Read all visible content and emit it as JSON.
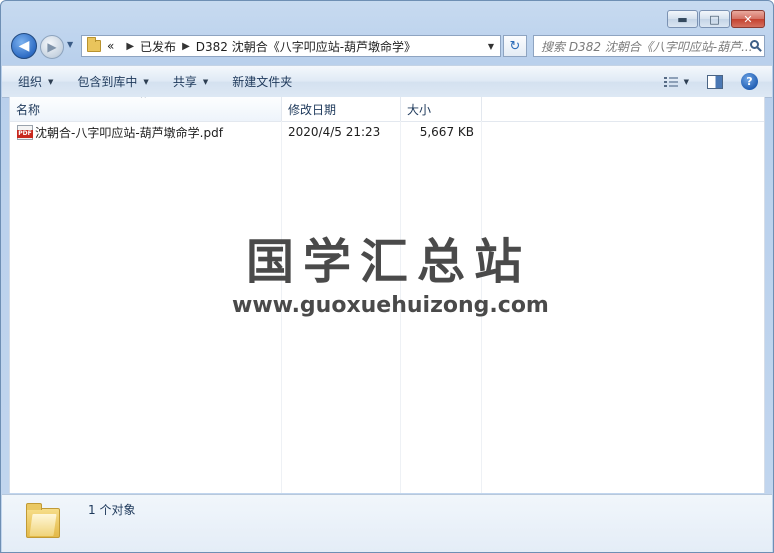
{
  "window": {
    "caption_buttons": {
      "minimize": "▬",
      "maximize": "□",
      "close": "✕"
    }
  },
  "address": {
    "overflow": "«",
    "crumbs": [
      "已发布",
      "D382 沈朝合《八字叩应站-葫芦墩命学》"
    ],
    "separator": "▶",
    "dropdown": "▼",
    "refresh": "↻"
  },
  "search": {
    "placeholder": "搜索 D382 沈朝合《八字叩应站-葫芦..."
  },
  "toolbar": {
    "organize": "组织",
    "include_in_library": "包含到库中",
    "share": "共享",
    "new_folder": "新建文件夹",
    "caret": "▼",
    "help": "?"
  },
  "columns": {
    "name": "名称",
    "date": "修改日期",
    "size": "大小",
    "sort_indicator": "^"
  },
  "files": [
    {
      "name": "沈朝合-八字叩应站-葫芦墩命学.pdf",
      "modified": "2020/4/5 21:23",
      "size": "5,667 KB",
      "icon": "pdf-icon"
    }
  ],
  "watermark": {
    "title": "国学汇总站",
    "url": "www.guoxuehuizong.com"
  },
  "details": {
    "count_text": "1 个对象"
  },
  "colors": {
    "accent": "#2e6cc4",
    "toolbar_text": "#1e395b",
    "close_red": "#c4412f"
  }
}
